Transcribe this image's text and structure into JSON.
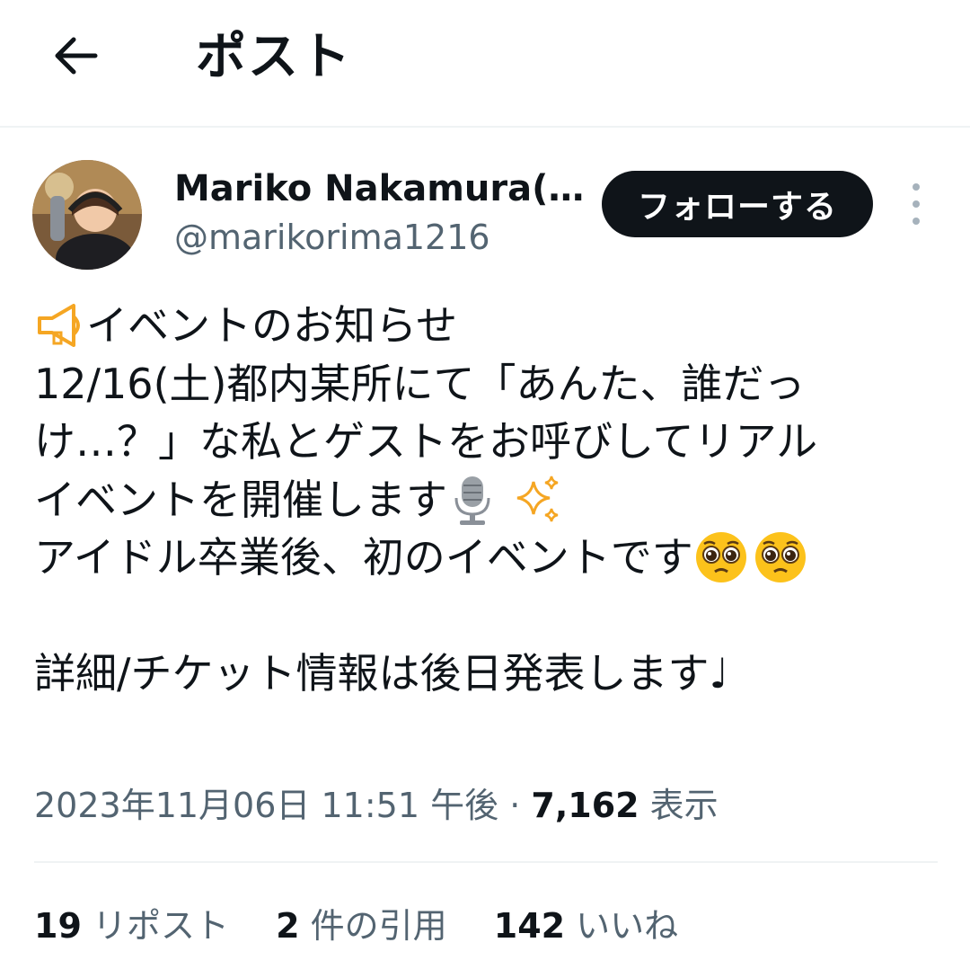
{
  "header": {
    "title": "ポスト"
  },
  "user": {
    "display_name": "Mariko Nakamura(…",
    "handle": "@marikorima1216",
    "follow_label": "フォローする"
  },
  "tweet": {
    "lines": [
      "イベントのお知らせ",
      "12/16(土)都内某所にて「あんた、誰だっ",
      "け…？」な私とゲストをお呼びしてリアル",
      "イベントを開催します",
      "アイドル卒業後、初のイベントです",
      "",
      "詳細/チケット情報は後日発表します♩"
    ],
    "icons": [
      "megaphone-icon",
      "microphone-icon",
      "sparkles-icon",
      "pleading-face-icon"
    ]
  },
  "meta": {
    "timestamp": "2023年11月06日 11:51 午後",
    "separator": "·",
    "views": "7,162",
    "views_label": "表示"
  },
  "stats": {
    "reposts": "19",
    "reposts_label": "リポスト",
    "quotes": "2",
    "quotes_label": "件の引用",
    "likes": "142",
    "likes_label": "いいね"
  },
  "colors": {
    "text": "#0f1419",
    "secondary": "#536471",
    "divider": "#eff3f4",
    "button": "#0f1419"
  }
}
